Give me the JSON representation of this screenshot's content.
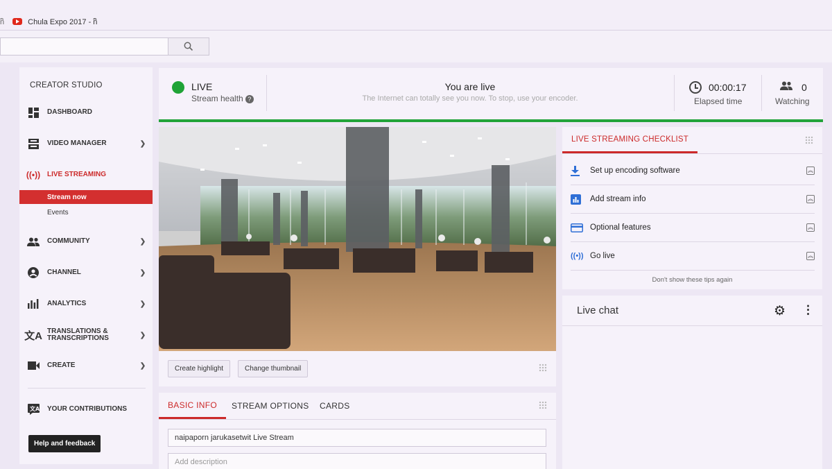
{
  "browser": {
    "tab_prev": "nิ",
    "tab_title": "Chula Expo 2017 - nิ",
    "search_icon": "search-icon"
  },
  "sidebar": {
    "title": "CREATOR STUDIO",
    "items": [
      {
        "label": "DASHBOARD",
        "icon": "dashboard-icon"
      },
      {
        "label": "VIDEO MANAGER",
        "icon": "video-manager-icon"
      },
      {
        "label": "LIVE STREAMING",
        "icon": "live-icon"
      },
      {
        "label": "COMMUNITY",
        "icon": "community-icon"
      },
      {
        "label": "CHANNEL",
        "icon": "channel-icon"
      },
      {
        "label": "ANALYTICS",
        "icon": "analytics-icon"
      },
      {
        "label": "TRANSLATIONS & TRANSCRIPTIONS",
        "icon": "translate-icon"
      },
      {
        "label": "CREATE",
        "icon": "create-icon"
      },
      {
        "label": "YOUR CONTRIBUTIONS",
        "icon": "contributions-icon"
      }
    ],
    "sub_items": [
      {
        "label": "Stream now"
      },
      {
        "label": "Events"
      }
    ],
    "help_button": "Help and feedback"
  },
  "status": {
    "live_label": "LIVE",
    "stream_health": "Stream health",
    "headline": "You are live",
    "subtext": "The Internet can totally see you now. To stop, use your encoder.",
    "elapsed_value": "00:00:17",
    "elapsed_label": "Elapsed time",
    "watching_value": "0",
    "watching_label": "Watching",
    "live_color": "#1fa336"
  },
  "video": {
    "create_highlight": "Create highlight",
    "change_thumbnail": "Change thumbnail"
  },
  "info": {
    "tabs": [
      {
        "label": "BASIC INFO"
      },
      {
        "label": "STREAM OPTIONS"
      },
      {
        "label": "CARDS"
      }
    ],
    "title_value": "naipaporn jarukasetwit Live Stream",
    "description_placeholder": "Add description"
  },
  "checklist": {
    "title": "LIVE STREAMING CHECKLIST",
    "items": [
      {
        "label": "Set up encoding software",
        "icon": "download-icon"
      },
      {
        "label": "Add stream info",
        "icon": "stats-icon"
      },
      {
        "label": "Optional features",
        "icon": "card-icon"
      },
      {
        "label": "Go live",
        "icon": "broadcast-icon"
      }
    ],
    "footer": "Don't show these tips again",
    "accent": "#cc2a2a"
  },
  "chat": {
    "title": "Live chat"
  }
}
